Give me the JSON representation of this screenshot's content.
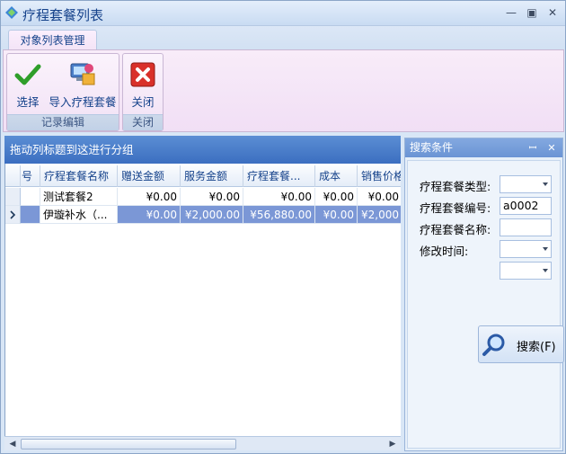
{
  "window": {
    "title": "疗程套餐列表"
  },
  "ribbon": {
    "tab": "对象列表管理",
    "groups": [
      {
        "label": "记录编辑",
        "buttons": [
          {
            "label": "选择"
          },
          {
            "label": "导入疗程套餐"
          }
        ]
      },
      {
        "label": "关闭",
        "buttons": [
          {
            "label": "关闭"
          }
        ]
      }
    ]
  },
  "grid": {
    "group_hint": "拖动列标题到这进行分组",
    "columns": [
      "号",
      "疗程套餐名称",
      "赠送金额",
      "服务金额",
      "疗程套餐...",
      "成本",
      "销售价格"
    ],
    "rows": [
      {
        "cells": [
          "",
          "测试套餐2",
          "¥0.00",
          "¥0.00",
          "¥0.00",
          "¥0.00",
          "¥0.00"
        ],
        "selected": false
      },
      {
        "cells": [
          "",
          "伊璇补水（...",
          "¥0.00",
          "¥2,000.00",
          "¥56,880.00",
          "¥0.00",
          "¥2,000"
        ],
        "selected": true
      }
    ]
  },
  "search_panel": {
    "title": "搜索条件",
    "fields": [
      {
        "label": "疗程套餐类型:",
        "value": "",
        "type": "dropdown"
      },
      {
        "label": "疗程套餐编号:",
        "value": "a0002",
        "type": "text"
      },
      {
        "label": "疗程套餐名称:",
        "value": "",
        "type": "text"
      },
      {
        "label": "修改时间:",
        "value": "",
        "type": "dropdown"
      },
      {
        "label": "",
        "value": "",
        "type": "dropdown"
      }
    ],
    "search_button": "搜索(F)"
  },
  "colors": {
    "accent": "#3b6ec0",
    "selection": "#7b97d6",
    "ribbon_bg": "#f1dff5"
  }
}
